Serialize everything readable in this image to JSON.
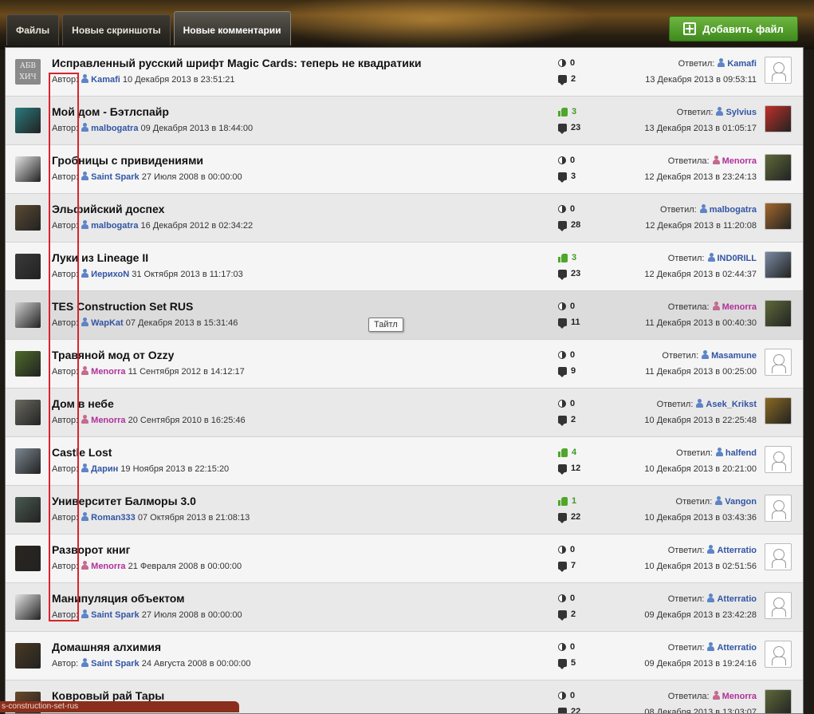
{
  "tabs": [
    {
      "label": "Файлы"
    },
    {
      "label": "Новые скриншоты"
    },
    {
      "label": "Новые комментарии"
    }
  ],
  "add_button_label": "Добавить файл",
  "author_label": "Автор:",
  "tooltip": "Тайтл",
  "status_url": "s-construction-set-rus",
  "rows": [
    {
      "title": "Исправленный русский шрифт Magic Cards: теперь не квадратики",
      "author": "Kamafi",
      "author_female": false,
      "date": "10 Декабря 2013 в 23:51:21",
      "rating": "0",
      "rating_positive": false,
      "comments": "2",
      "reply_label": "Ответил:",
      "reply_user": "Kamafi",
      "reply_female": false,
      "reply_date": "13 Декабря 2013 в 09:53:11",
      "thumb_color": "#8a8a8a",
      "avatar_color": "",
      "thumb_text": "АБВ ХИЧ"
    },
    {
      "title": "Мой дом - Бэтлспайр",
      "author": "malbogatra",
      "author_female": false,
      "date": "09 Декабря 2013 в 18:44:00",
      "rating": "3",
      "rating_positive": true,
      "comments": "23",
      "reply_label": "Ответил:",
      "reply_user": "Sylvius",
      "reply_female": false,
      "reply_date": "13 Декабря 2013 в 01:05:17",
      "thumb_color": "#2a7a7e",
      "avatar_color": "#c0302a",
      "thumb_text": ""
    },
    {
      "title": "Гробницы с привидениями",
      "author": "Saint Spark",
      "author_female": false,
      "date": "27 Июля 2008 в 00:00:00",
      "rating": "0",
      "rating_positive": false,
      "comments": "3",
      "reply_label": "Ответила:",
      "reply_user": "Menorra",
      "reply_female": true,
      "reply_date": "12 Декабря 2013 в 23:24:13",
      "thumb_color": "#e4e4e4",
      "avatar_color": "#5d6a3a",
      "thumb_text": ""
    },
    {
      "title": "Эльфийский доспех",
      "author": "malbogatra",
      "author_female": false,
      "date": "16 Декабря 2012 в 02:34:22",
      "rating": "0",
      "rating_positive": false,
      "comments": "28",
      "reply_label": "Ответил:",
      "reply_user": "malbogatra",
      "reply_female": false,
      "reply_date": "12 Декабря 2013 в 11:20:08",
      "thumb_color": "#5b4a33",
      "avatar_color": "#a3682c",
      "thumb_text": ""
    },
    {
      "title": "Луки из Lineage II",
      "author": "ИерихоN",
      "author_female": false,
      "date": "31 Октября 2013 в 11:17:03",
      "rating": "3",
      "rating_positive": true,
      "comments": "23",
      "reply_label": "Ответил:",
      "reply_user": "IND0RILL",
      "reply_female": false,
      "reply_date": "12 Декабря 2013 в 02:44:37",
      "thumb_color": "#3a3a3a",
      "avatar_color": "#7a8aa3",
      "thumb_text": ""
    },
    {
      "title": "TES Construction Set RUS",
      "author": "WapKat",
      "author_female": false,
      "date": "07 Декабря 2013 в 15:31:46",
      "rating": "0",
      "rating_positive": false,
      "comments": "11",
      "reply_label": "Ответила:",
      "reply_user": "Menorra",
      "reply_female": true,
      "reply_date": "11 Декабря 2013 в 00:40:30",
      "thumb_color": "#cfcfcf",
      "avatar_color": "#5d6a3a",
      "thumb_text": ""
    },
    {
      "title": "Травяной мод от Ozzy",
      "author": "Menorra",
      "author_female": true,
      "date": "11 Сентября 2012 в 14:12:17",
      "rating": "0",
      "rating_positive": false,
      "comments": "9",
      "reply_label": "Ответил:",
      "reply_user": "Masamune",
      "reply_female": false,
      "reply_date": "11 Декабря 2013 в 00:25:00",
      "thumb_color": "#4d6b2a",
      "avatar_color": "",
      "thumb_text": ""
    },
    {
      "title": "Дом в небе",
      "author": "Menorra",
      "author_female": true,
      "date": "20 Сентября 2010 в 16:25:46",
      "rating": "0",
      "rating_positive": false,
      "comments": "2",
      "reply_label": "Ответил:",
      "reply_user": "Asek_Krikst",
      "reply_female": false,
      "reply_date": "10 Декабря 2013 в 22:25:48",
      "thumb_color": "#6b6b62",
      "avatar_color": "#8a6a22",
      "thumb_text": ""
    },
    {
      "title": "Castle Lost",
      "author": "Дарин",
      "author_female": false,
      "date": "19 Ноября 2013 в 22:15:20",
      "rating": "4",
      "rating_positive": true,
      "comments": "12",
      "reply_label": "Ответил:",
      "reply_user": "halfend",
      "reply_female": false,
      "reply_date": "10 Декабря 2013 в 20:21:00",
      "thumb_color": "#7c8892",
      "avatar_color": "",
      "thumb_text": ""
    },
    {
      "title": "Университет Балморы 3.0",
      "author": "Roman333",
      "author_female": false,
      "date": "07 Октября 2013 в 21:08:13",
      "rating": "1",
      "rating_positive": true,
      "comments": "22",
      "reply_label": "Ответил:",
      "reply_user": "Vangon",
      "reply_female": false,
      "reply_date": "10 Декабря 2013 в 03:43:36",
      "thumb_color": "#4a5a52",
      "avatar_color": "",
      "thumb_text": ""
    },
    {
      "title": "Разворот книг",
      "author": "Menorra",
      "author_female": true,
      "date": "21 Февраля 2008 в 00:00:00",
      "rating": "0",
      "rating_positive": false,
      "comments": "7",
      "reply_label": "Ответил:",
      "reply_user": "Atterratio",
      "reply_female": false,
      "reply_date": "10 Декабря 2013 в 02:51:56",
      "thumb_color": "#2a2620",
      "avatar_color": "",
      "thumb_text": ""
    },
    {
      "title": "Манипуляция объектом",
      "author": "Saint Spark",
      "author_female": false,
      "date": "27 Июля 2008 в 00:00:00",
      "rating": "0",
      "rating_positive": false,
      "comments": "2",
      "reply_label": "Ответил:",
      "reply_user": "Atterratio",
      "reply_female": false,
      "reply_date": "09 Декабря 2013 в 23:42:28",
      "thumb_color": "#e4e4e4",
      "avatar_color": "",
      "thumb_text": ""
    },
    {
      "title": "Домашняя алхимия",
      "author": "Saint Spark",
      "author_female": false,
      "date": "24 Августа 2008 в 00:00:00",
      "rating": "0",
      "rating_positive": false,
      "comments": "5",
      "reply_label": "Ответил:",
      "reply_user": "Atterratio",
      "reply_female": false,
      "reply_date": "09 Декабря 2013 в 19:24:16",
      "thumb_color": "#4a3a22",
      "avatar_color": "",
      "thumb_text": ""
    },
    {
      "title": "Ковровый рай Тары",
      "author": "",
      "author_female": false,
      "date": "",
      "rating": "0",
      "rating_positive": false,
      "comments": "22",
      "reply_label": "Ответила:",
      "reply_user": "Menorra",
      "reply_female": true,
      "reply_date": "08 Декабря 2013 в 13:03:07",
      "thumb_color": "#6a4a2a",
      "avatar_color": "#5d6a3a",
      "thumb_text": ""
    }
  ]
}
